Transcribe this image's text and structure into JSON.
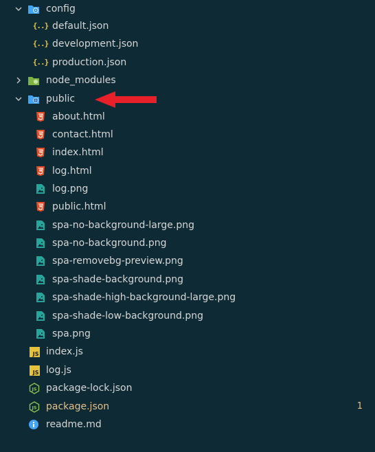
{
  "explorer": {
    "items": [
      {
        "label": "config",
        "type": "folder",
        "icon": "config-folder-icon",
        "expanded": true
      },
      {
        "label": "default.json",
        "type": "json",
        "icon": "json-file-icon"
      },
      {
        "label": "development.json",
        "type": "json",
        "icon": "json-file-icon"
      },
      {
        "label": "production.json",
        "type": "json",
        "icon": "json-file-icon"
      },
      {
        "label": "node_modules",
        "type": "folder",
        "icon": "node-folder-icon",
        "expanded": false
      },
      {
        "label": "public",
        "type": "folder",
        "icon": "public-folder-icon",
        "expanded": true
      },
      {
        "label": "about.html",
        "type": "html",
        "icon": "html5-file-icon"
      },
      {
        "label": "contact.html",
        "type": "html",
        "icon": "html5-file-icon"
      },
      {
        "label": "index.html",
        "type": "html",
        "icon": "html5-file-icon"
      },
      {
        "label": "log.html",
        "type": "html",
        "icon": "html5-file-icon"
      },
      {
        "label": "log.png",
        "type": "image",
        "icon": "image-file-icon"
      },
      {
        "label": "public.html",
        "type": "html",
        "icon": "html5-file-icon"
      },
      {
        "label": "spa-no-background-large.png",
        "type": "image",
        "icon": "image-file-icon"
      },
      {
        "label": "spa-no-background.png",
        "type": "image",
        "icon": "image-file-icon"
      },
      {
        "label": "spa-removebg-preview.png",
        "type": "image",
        "icon": "image-file-icon"
      },
      {
        "label": "spa-shade-background.png",
        "type": "image",
        "icon": "image-file-icon"
      },
      {
        "label": "spa-shade-high-background-large.png",
        "type": "image",
        "icon": "image-file-icon"
      },
      {
        "label": "spa-shade-low-background.png",
        "type": "image",
        "icon": "image-file-icon"
      },
      {
        "label": "spa.png",
        "type": "image",
        "icon": "image-file-icon"
      },
      {
        "label": "index.js",
        "type": "js",
        "icon": "javascript-file-icon"
      },
      {
        "label": "log.js",
        "type": "js",
        "icon": "javascript-file-icon"
      },
      {
        "label": "package-lock.json",
        "type": "nodejson",
        "icon": "nodejs-file-icon"
      },
      {
        "label": "package.json",
        "type": "nodejson",
        "icon": "nodejs-file-icon",
        "modified": true,
        "badge": "1"
      },
      {
        "label": "readme.md",
        "type": "info",
        "icon": "info-file-icon"
      }
    ],
    "js_icon_text": "JS",
    "json_icon_text": "{..}"
  },
  "colors": {
    "background": "#0e2a35",
    "modified": "#e2c08d",
    "arrow": "#e8202a",
    "html": "#e44d26",
    "image": "#26a69a",
    "json": "#e8c547",
    "node": "#8bc34a",
    "folder": "#42a5f5"
  }
}
